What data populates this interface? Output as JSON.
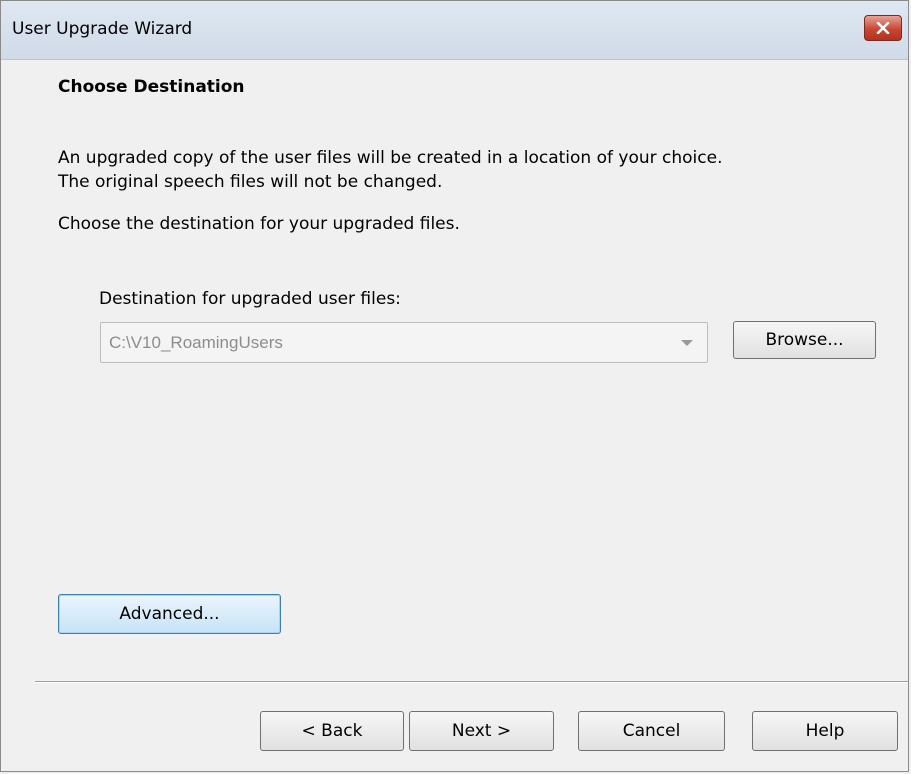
{
  "window": {
    "title": "User Upgrade Wizard"
  },
  "page": {
    "heading": "Choose Destination",
    "description_line1": "An upgraded copy of the user files will be created in a location of your choice.",
    "description_line2": "The original speech files will not be changed.",
    "instruction": "Choose the destination for your upgraded files."
  },
  "destination": {
    "label": "Destination for upgraded user files:",
    "value": "C:\\V10_RoamingUsers",
    "enabled": false,
    "browse_label": "Browse..."
  },
  "advanced_label": "Advanced...",
  "footer": {
    "back_label": "< Back",
    "next_label": "Next >",
    "cancel_label": "Cancel",
    "help_label": "Help"
  },
  "icons": {
    "close": "close-icon",
    "dropdown": "chevron-down-icon"
  },
  "colors": {
    "close_button": "#c94734",
    "focus_button_border": "#3c7fb1",
    "disabled_text": "#8d8d8d"
  }
}
